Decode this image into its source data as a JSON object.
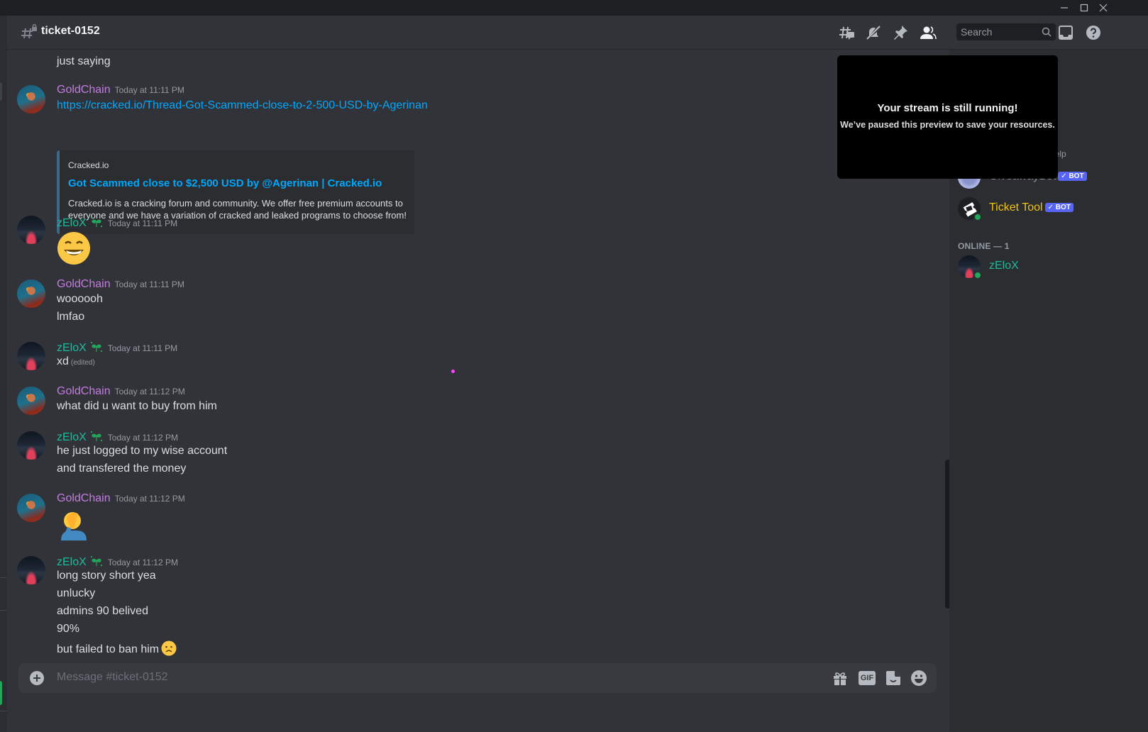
{
  "window": {
    "controls": [
      "minimize",
      "maximize",
      "close"
    ]
  },
  "header": {
    "channel_icon": "hash-lock-icon",
    "channel_name": "ticket-0152",
    "icons": [
      "threads-icon",
      "notifications-muted-icon",
      "pinned-icon",
      "member-list-icon"
    ],
    "search_placeholder": "Search",
    "right_icons": [
      "inbox-icon",
      "help-icon"
    ]
  },
  "messages": [
    {
      "continuation": true,
      "lines": [
        "just saying"
      ]
    },
    {
      "author": "GoldChain",
      "author_color": "#c27ce0",
      "timestamp": "Today at 11:11 PM",
      "link": "https://cracked.io/Thread-Got-Scammed-close-to-2-500-USD-by-Agerinan",
      "embed": {
        "provider": "Cracked.io",
        "title": "Got Scammed close to $2,500 USD by @Agerinan | Cracked.io",
        "description": "Cracked.io is a cracking forum and community. We offer free premium accounts to everyone and we have a variation of cracked and leaked programs to choose from!"
      }
    },
    {
      "author": "zEloX",
      "author_color": "#1abc9c",
      "badge": "sprout-badge-icon",
      "timestamp": "Today at 11:11 PM",
      "emoji": "grinning-squinting-face"
    },
    {
      "author": "GoldChain",
      "author_color": "#c27ce0",
      "timestamp": "Today at 11:11 PM",
      "lines": [
        "woooooh",
        "lmfao"
      ]
    },
    {
      "author": "zEloX",
      "author_color": "#1abc9c",
      "badge": "sprout-badge-icon",
      "timestamp": "Today at 11:11 PM",
      "lines": [
        "xd"
      ],
      "edited_label": "(edited)"
    },
    {
      "author": "GoldChain",
      "author_color": "#c27ce0",
      "timestamp": "Today at 11:12 PM",
      "lines": [
        "what did u want to buy from him"
      ]
    },
    {
      "author": "zEloX",
      "author_color": "#1abc9c",
      "badge": "sprout-badge-icon",
      "timestamp": "Today at 11:12 PM",
      "lines": [
        "he just logged to my wise account",
        "and transfered the money"
      ]
    },
    {
      "author": "GoldChain",
      "author_color": "#c27ce0",
      "timestamp": "Today at 11:12 PM",
      "emoji": "person-facepalming"
    },
    {
      "author": "zEloX",
      "author_color": "#1abc9c",
      "badge": "sprout-badge-icon",
      "timestamp": "Today at 11:12 PM",
      "lines": [
        "long story short yea",
        "unlucky",
        "admins 90 belived",
        "90%",
        "but failed to ban him"
      ],
      "trailing_emoji": "slightly-frowning-face"
    }
  ],
  "composer": {
    "placeholder": "Message #ticket-0152",
    "icons": [
      "gift-icon",
      "gif-icon",
      "sticker-icon",
      "emoji-icon"
    ],
    "gif_label": "GIF"
  },
  "members": {
    "partial_text": "help",
    "bots": [
      {
        "name": "GiveawayBot",
        "badge": "BOT",
        "name_color": "#949ba4"
      },
      {
        "name": "Ticket Tool",
        "badge": "BOT",
        "name_color": "#f1c40f",
        "status": "online"
      }
    ],
    "online_header": "ONLINE — 1",
    "online": [
      {
        "name": "zEloX",
        "name_color": "#1abc9c",
        "status": "online"
      }
    ]
  },
  "stream_overlay": {
    "title": "Your stream is still running!",
    "subtitle": "We’ve paused this preview to save your resources."
  }
}
